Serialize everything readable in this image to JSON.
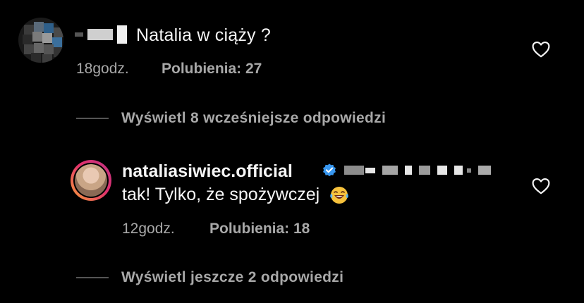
{
  "comment1": {
    "text": "Natalia w ciąży ?",
    "time": "18godz.",
    "likes": "Polubienia: 27",
    "like_icon": "heart-outline-icon"
  },
  "view_earlier_replies": "Wyświetl 8 wcześniejsze odpowiedzi",
  "comment2": {
    "username": "nataliasiwiec.official",
    "verified_icon": "verified-badge-icon",
    "text": "tak! Tylko, że spożywczej",
    "emoji": "face-with-tears-of-joy",
    "time": "12godz.",
    "likes": "Polubienia: 18",
    "like_icon": "heart-outline-icon"
  },
  "view_more_replies": "Wyświetl jeszcze 2 odpowiedzi",
  "colors": {
    "background": "#000000",
    "primary_text": "#f5f5f5",
    "secondary_text": "#a8a8a8",
    "verified_blue": "#3897f0"
  }
}
